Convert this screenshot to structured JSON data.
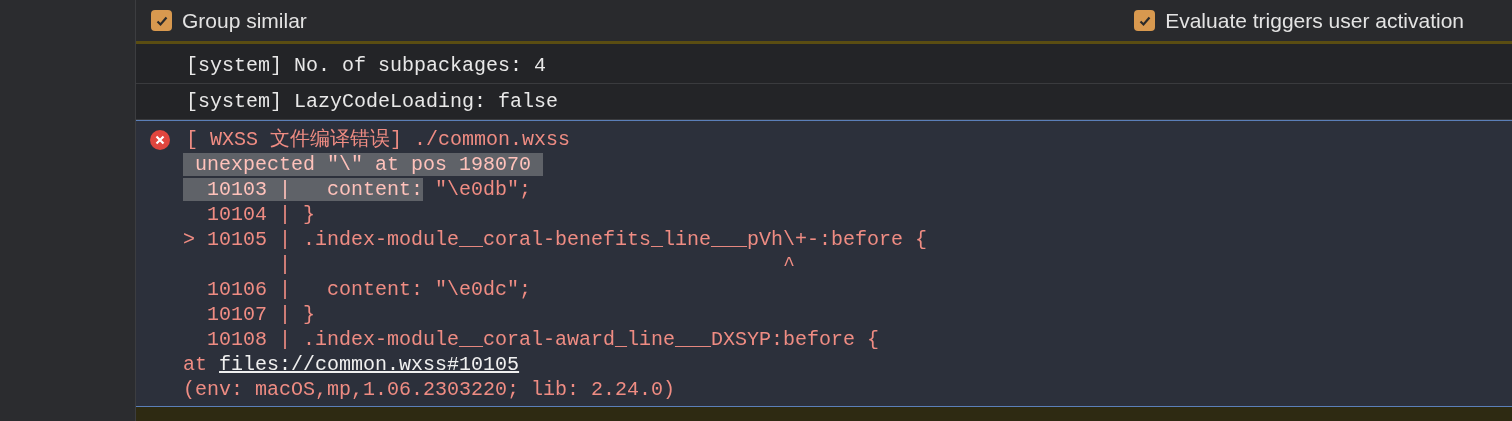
{
  "toolbar": {
    "options": [
      {
        "label": "Group similar",
        "checked": true
      },
      {
        "label": "Evaluate triggers user activation",
        "checked": true
      }
    ]
  },
  "messages": [
    {
      "kind": "info",
      "text": "[system] No. of subpackages: 4"
    },
    {
      "kind": "info",
      "text": "[system] LazyCodeLoading: false"
    }
  ],
  "error": {
    "title": "[ WXSS 文件编译错误] ./common.wxss",
    "lines": [
      {
        "selected": " unexpected \"\\\" at pos 198070 "
      },
      {
        "selected": "  10103 |   content:",
        "after": " \"\\e0db\";"
      },
      {
        "before": "  10104 | }"
      },
      {
        "before": "> 10105 | .index-module__coral-benefits_line___pVh\\+-:before {"
      },
      {
        "before": "        |                                         ^"
      },
      {
        "before": "  10106 |   content: \"\\e0dc\";"
      },
      {
        "before": "  10107 | }"
      },
      {
        "before": "  10108 | .index-module__coral-award_line___DXSYP:before {"
      }
    ],
    "at_prefix": "at",
    "link": "files://common.wxss#10105",
    "env": "(env: macOS,mp,1.06.2303220; lib: 2.24.0)"
  }
}
